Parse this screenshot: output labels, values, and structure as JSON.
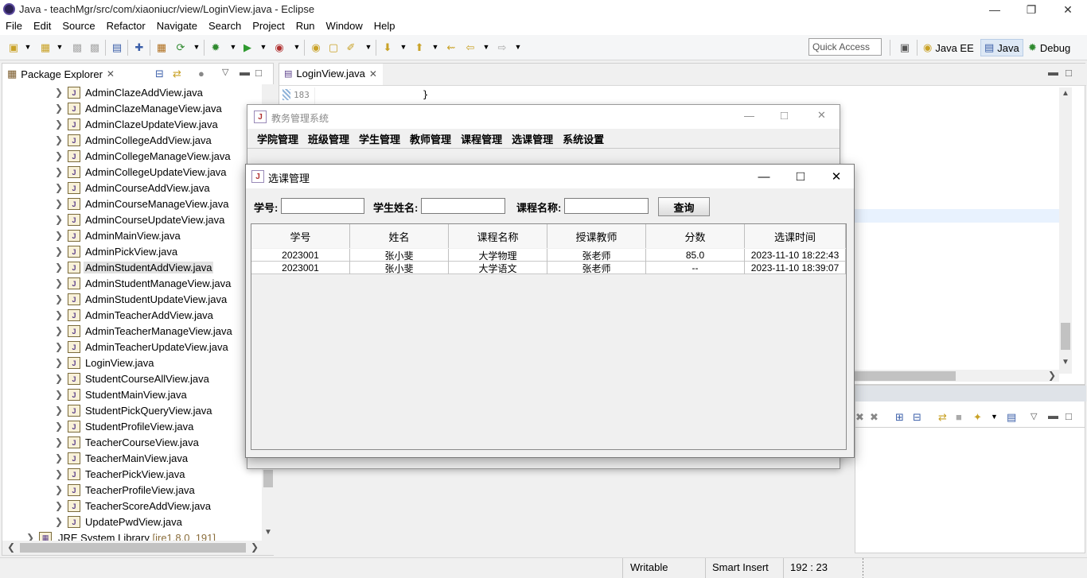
{
  "window": {
    "title": "Java - teachMgr/src/com/xiaoniucr/view/LoginView.java - Eclipse"
  },
  "menubar": [
    "File",
    "Edit",
    "Source",
    "Refactor",
    "Navigate",
    "Search",
    "Project",
    "Run",
    "Window",
    "Help"
  ],
  "toolbar": {
    "quick_access": "Quick Access",
    "perspectives": [
      {
        "label": "Java EE"
      },
      {
        "label": "Java",
        "active": true
      },
      {
        "label": "Debug"
      }
    ]
  },
  "package_explorer": {
    "title": "Package Explorer",
    "items": [
      "AdminClazeAddView.java",
      "AdminClazeManageView.java",
      "AdminClazeUpdateView.java",
      "AdminCollegeAddView.java",
      "AdminCollegeManageView.java",
      "AdminCollegeUpdateView.java",
      "AdminCourseAddView.java",
      "AdminCourseManageView.java",
      "AdminCourseUpdateView.java",
      "AdminMainView.java",
      "AdminPickView.java",
      "AdminStudentAddView.java",
      "AdminStudentManageView.java",
      "AdminStudentUpdateView.java",
      "AdminTeacherAddView.java",
      "AdminTeacherManageView.java",
      "AdminTeacherUpdateView.java",
      "LoginView.java",
      "StudentCourseAllView.java",
      "StudentMainView.java",
      "StudentPickQueryView.java",
      "StudentProfileView.java",
      "TeacherCourseView.java",
      "TeacherMainView.java",
      "TeacherPickView.java",
      "TeacherProfileView.java",
      "TeacherScoreAddView.java",
      "UpdatePwdView.java"
    ],
    "selected_index": 11,
    "jre_label": "JRE System Library",
    "jre_version": "[jre1.8.0_191]"
  },
  "editor": {
    "tab": "LoginView.java",
    "line_number": "183",
    "code_line": "}"
  },
  "statusbar": {
    "writable": "Writable",
    "insert": "Smart Insert",
    "position": "192 : 23"
  },
  "main_window": {
    "title": "教务管理系统",
    "menu": [
      "学院管理",
      "班级管理",
      "学生管理",
      "教师管理",
      "课程管理",
      "选课管理",
      "系统设置"
    ]
  },
  "dialog": {
    "title": "选课管理",
    "fields": {
      "student_id_label": "学号:",
      "student_name_label": "学生姓名:",
      "course_name_label": "课程名称:",
      "student_id_value": "",
      "student_name_value": "",
      "course_name_value": ""
    },
    "query_button": "查询",
    "table": {
      "columns": [
        "学号",
        "姓名",
        "课程名称",
        "授课教师",
        "分数",
        "选课时间"
      ],
      "rows": [
        [
          "2023001",
          "张小斐",
          "大学物理",
          "张老师",
          "85.0",
          "2023-11-10 18:22:43"
        ],
        [
          "2023001",
          "张小斐",
          "大学语文",
          "张老师",
          "--",
          "2023-11-10 18:39:07"
        ]
      ]
    }
  }
}
